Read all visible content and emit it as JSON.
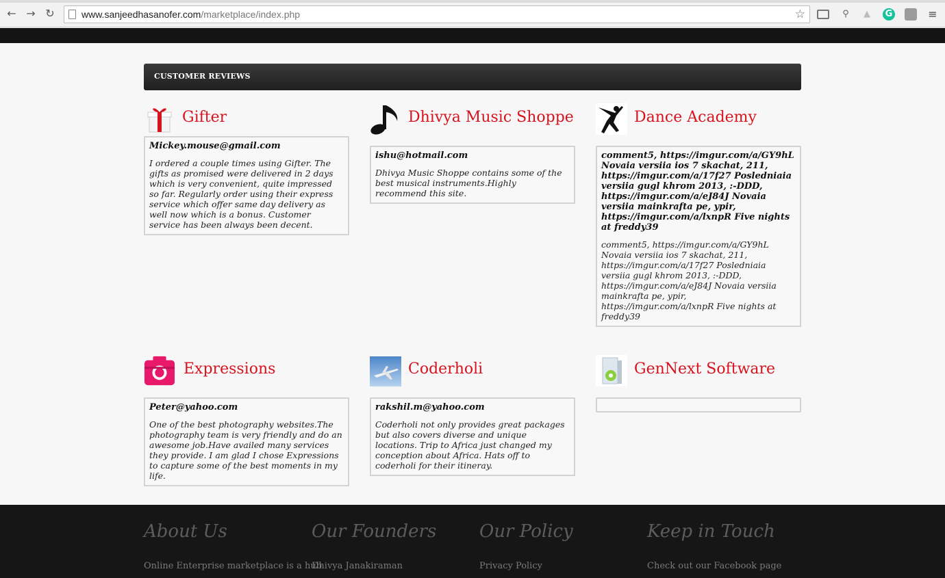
{
  "browser": {
    "url_host": "www.sanjeedhasanofer.com",
    "url_path": "/marketplace/index.php"
  },
  "section": {
    "title": "CUSTOMER REVIEWS"
  },
  "reviews": [
    {
      "name": "Gifter",
      "icon": "gift-icon",
      "email": "Mickey.mouse@gmail.com",
      "text": "I ordered a couple times using Gifter. The gifts as promised were delivered in 2 days which is very convenient, quite impressed so far. Regularly order using their express service which offer same day delivery as well now which is a bonus. Customer service has been always been decent."
    },
    {
      "name": "Dhivya Music Shoppe",
      "icon": "music-note-icon",
      "email": "ishu@hotmail.com",
      "text": "Dhivya Music Shoppe contains some of the best musical instruments.Highly recommend this site."
    },
    {
      "name": "Dance Academy",
      "icon": "dancer-icon",
      "email": "comment5, https://imgur.com/a/GY9hL Novaia versiia ios 7 skachat, 211, https://imgur.com/a/17f27 Posledniaia versiia gugl khrom 2013, :-DDD, https://imgur.com/a/eJ84J Novaia versiia mainkrafta pe, ypir, https://imgur.com/a/lxnpR Five nights at freddy39",
      "text": "comment5, https://imgur.com/a/GY9hL Novaia versiia ios 7 skachat, 211, https://imgur.com/a/17f27 Posledniaia versiia gugl khrom 2013, :-DDD, https://imgur.com/a/eJ84J Novaia versiia mainkrafta pe, ypir, https://imgur.com/a/lxnpR Five nights at freddy39"
    },
    {
      "name": "Expressions",
      "icon": "camera-icon",
      "email": "Peter@yahoo.com",
      "text": "One of the best photography websites.The photography team is very friendly and do an awesome job.Have availed many services they provide. I am glad I chose Expressions to capture some of the best moments in my life."
    },
    {
      "name": "Coderholi",
      "icon": "airplane-icon",
      "email": "rakshil.m@yahoo.com",
      "text": "Coderholi not only provides great packages but also covers diverse and unique locations. Trip to Africa just changed my conception about Africa. Hats off to coderholi for their itineray."
    },
    {
      "name": "GenNext Software",
      "icon": "software-box-icon",
      "email": "",
      "text": ""
    }
  ],
  "footer": {
    "columns": [
      {
        "heading": "About Us",
        "text": "Online Enterprise marketplace is a hub"
      },
      {
        "heading": "Our Founders",
        "text": "Dhivya Janakiraman"
      },
      {
        "heading": "Our Policy",
        "text": "Privacy Policy"
      },
      {
        "heading": "Keep in Touch",
        "text": "Check out our Facebook page"
      }
    ]
  },
  "colors": {
    "accent": "#d6141f",
    "header_bg": "#2a2a2a",
    "footer_bg": "#161616"
  }
}
